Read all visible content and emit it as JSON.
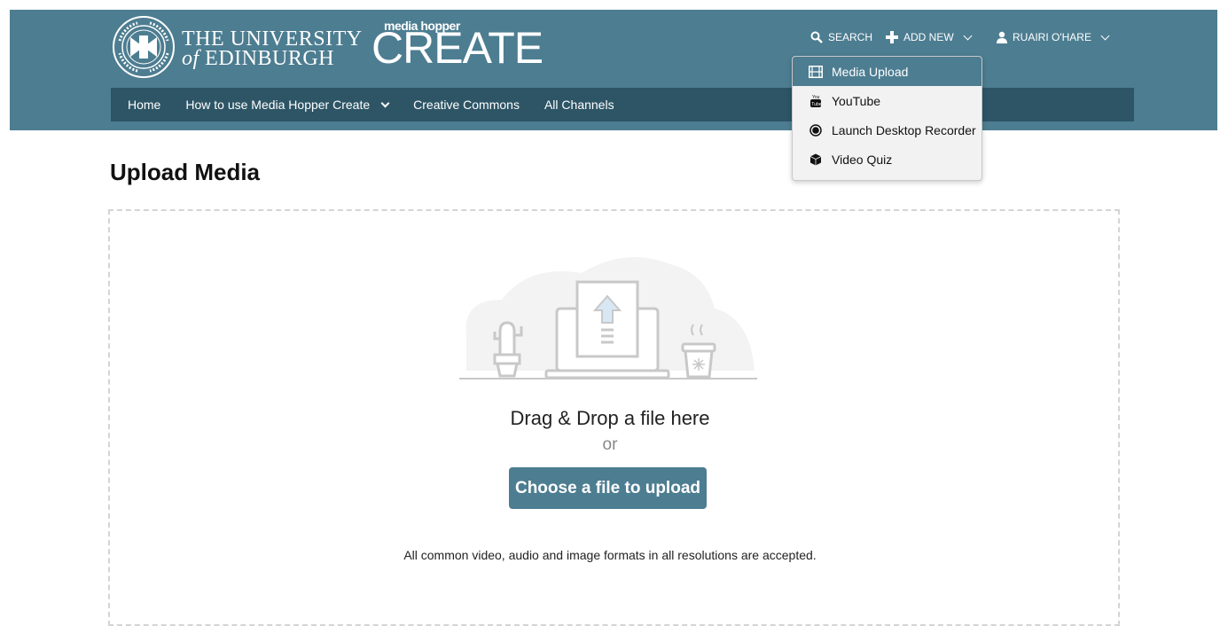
{
  "header": {
    "university_line1": "THE UNIVERSITY",
    "university_line2_italic": "of",
    "university_line2": "EDINBURGH",
    "logo_small": "media hopper",
    "logo_big": "CREATE",
    "search_label": "SEARCH",
    "add_new_label": "ADD NEW",
    "user_label": "RUAIRI O'HARE",
    "bg_color": "#4d7d91"
  },
  "mainnav": {
    "items": [
      {
        "label": "Home"
      },
      {
        "label": "How to use Media Hopper Create"
      },
      {
        "label": "Creative Commons"
      },
      {
        "label": "All Channels"
      }
    ]
  },
  "add_new_menu": {
    "items": [
      {
        "label": "Media Upload",
        "icon": "film-icon"
      },
      {
        "label": "YouTube",
        "icon": "youtube-icon"
      },
      {
        "label": "Launch Desktop Recorder",
        "icon": "record-icon"
      },
      {
        "label": "Video Quiz",
        "icon": "cube-icon"
      }
    ]
  },
  "main": {
    "title": "Upload Media",
    "drag_text": "Drag & Drop a file here",
    "or_text": "or",
    "upload_button": "Choose a file to upload",
    "formats_note": "All common video, audio and image formats in all resolutions are accepted."
  }
}
